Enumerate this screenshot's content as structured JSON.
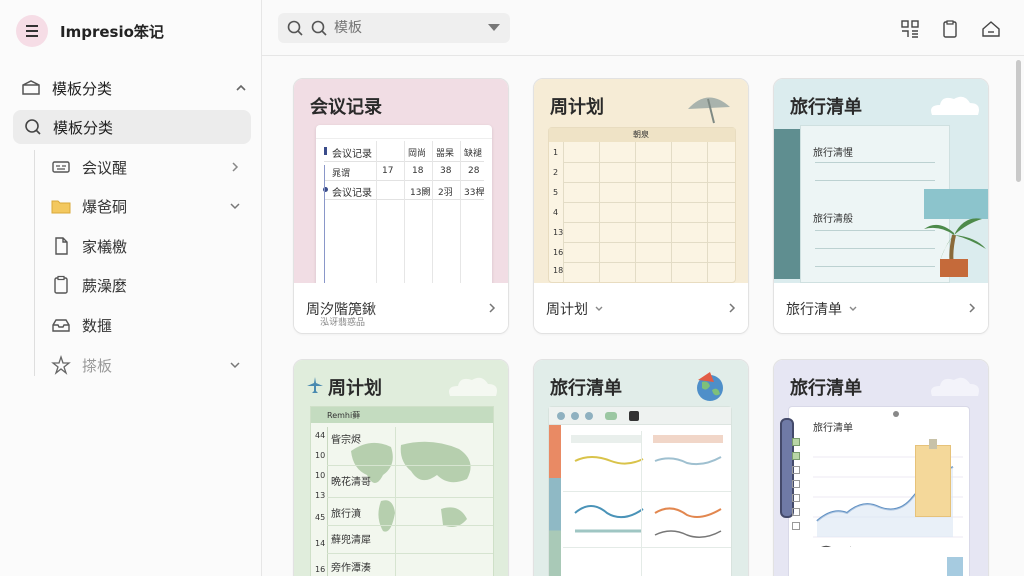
{
  "app": {
    "title": "Impresio笨记"
  },
  "sidebar": {
    "section": {
      "label": "模板分类"
    },
    "selected": {
      "label": "模板分类"
    },
    "items": [
      {
        "label": "会议醒",
        "icon": "keyboard-icon",
        "chevron": "right"
      },
      {
        "label": "爆爸硐",
        "icon": "folder-icon",
        "chevron": "down"
      },
      {
        "label": "家檥檄",
        "icon": "document-icon",
        "chevron": ""
      },
      {
        "label": "蕨澡麼",
        "icon": "clipboard-icon",
        "chevron": ""
      },
      {
        "label": "数擓",
        "icon": "inbox-icon",
        "chevron": ""
      },
      {
        "label": "搽板",
        "icon": "star-icon",
        "chevron": "down"
      }
    ]
  },
  "search": {
    "placeholder": "模板"
  },
  "cards": [
    {
      "title": "会议记录",
      "footer_label": "周汐階箎鍬",
      "footer_sub": "泓讶翡惑品",
      "sheet": {
        "rows": [
          [
            "会议记录",
            "岡尚",
            "噐杲",
            "缺褪"
          ],
          [
            "晁谓",
            "17",
            "18",
            "38",
            "28"
          ],
          [
            "会议记录",
            "13闕",
            "2羽",
            "33桿"
          ]
        ]
      },
      "colors": {
        "bg": "#f1dde4"
      }
    },
    {
      "title": "周计划",
      "footer_label": "周计划",
      "sheet": {
        "header": "朝泉",
        "days": [
          "1",
          "2",
          "5",
          "4",
          "13",
          "16",
          "18"
        ]
      },
      "colors": {
        "bg": "#f6ecd6"
      }
    },
    {
      "title": "旅行清单",
      "footer_label": "旅行清单",
      "sheet": {
        "line1": "旅行清惺",
        "line2": "旅行清般"
      },
      "colors": {
        "bg": "#dbecee"
      }
    },
    {
      "title": "周计划",
      "sheet": {
        "header": "Remhi藓",
        "lines": [
          "眥宗烬",
          "晩花清哥",
          "旅行濆",
          "蘚兜清犀",
          "旁作潭湊"
        ],
        "nums": [
          "44",
          "10",
          "10",
          "13",
          "45",
          "14",
          "16"
        ]
      },
      "colors": {
        "bg": "#e0eddc"
      }
    },
    {
      "title": "旅行清单",
      "colors": {
        "bg": "#e1ede9"
      }
    },
    {
      "title": "旅行清单",
      "sheet": {
        "line1": "旅行清单"
      },
      "colors": {
        "bg": "#e6e6f3"
      }
    }
  ]
}
